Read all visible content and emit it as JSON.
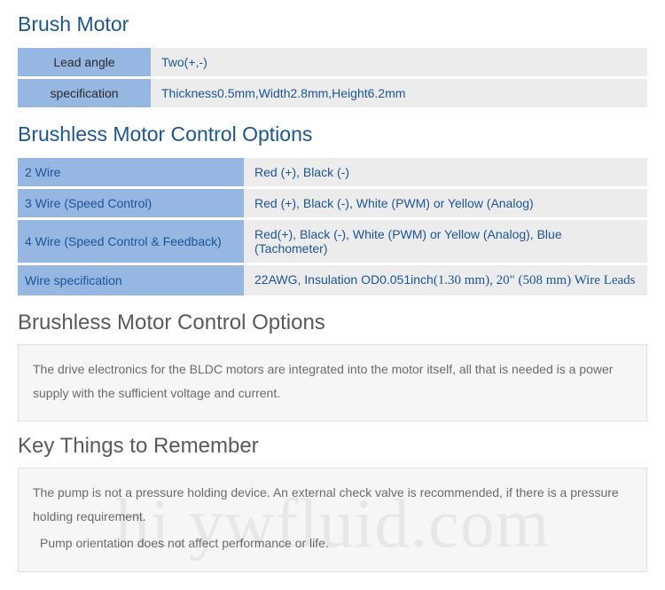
{
  "section1": {
    "title": "Brush Motor",
    "rows": [
      {
        "label": "Lead angle",
        "value": "Two(+,-)"
      },
      {
        "label": "specification",
        "value": "Thickness0.5mm,Width2.8mm,Height6.2mm"
      }
    ]
  },
  "section2": {
    "title": "Brushless Motor Control Options",
    "rows": [
      {
        "label": "2 Wire",
        "value": "Red (+), Black (-)"
      },
      {
        "label": "3 Wire (Speed Control)",
        "value": "Red (+), Black (-), White (PWM) or Yellow (Analog)"
      },
      {
        "label": "4 Wire (Speed Control & Feedback)",
        "value": "Red(+), Black (-), White (PWM) or Yellow (Analog), Blue (Tachometer)"
      },
      {
        "label": "Wire specification",
        "value_pre": "22AWG, Insulation OD0.051inch",
        "value_post": "(1.30 mm), 20\" (508 mm) Wire Leads"
      }
    ]
  },
  "section3": {
    "title": "Brushless Motor Control Options",
    "body": "The drive electronics for the BLDC motors are integrated into the motor itself, all that is needed is a power supply with the sufficient voltage and current."
  },
  "section4": {
    "title": "Key Things to Remember",
    "body1": "The pump is not a pressure holding device. An external check valve is recommended, if there is a pressure holding requirement.",
    "body2": "Pump orientation does not affect performance or life."
  },
  "watermark": "hi.ywfluid.com"
}
